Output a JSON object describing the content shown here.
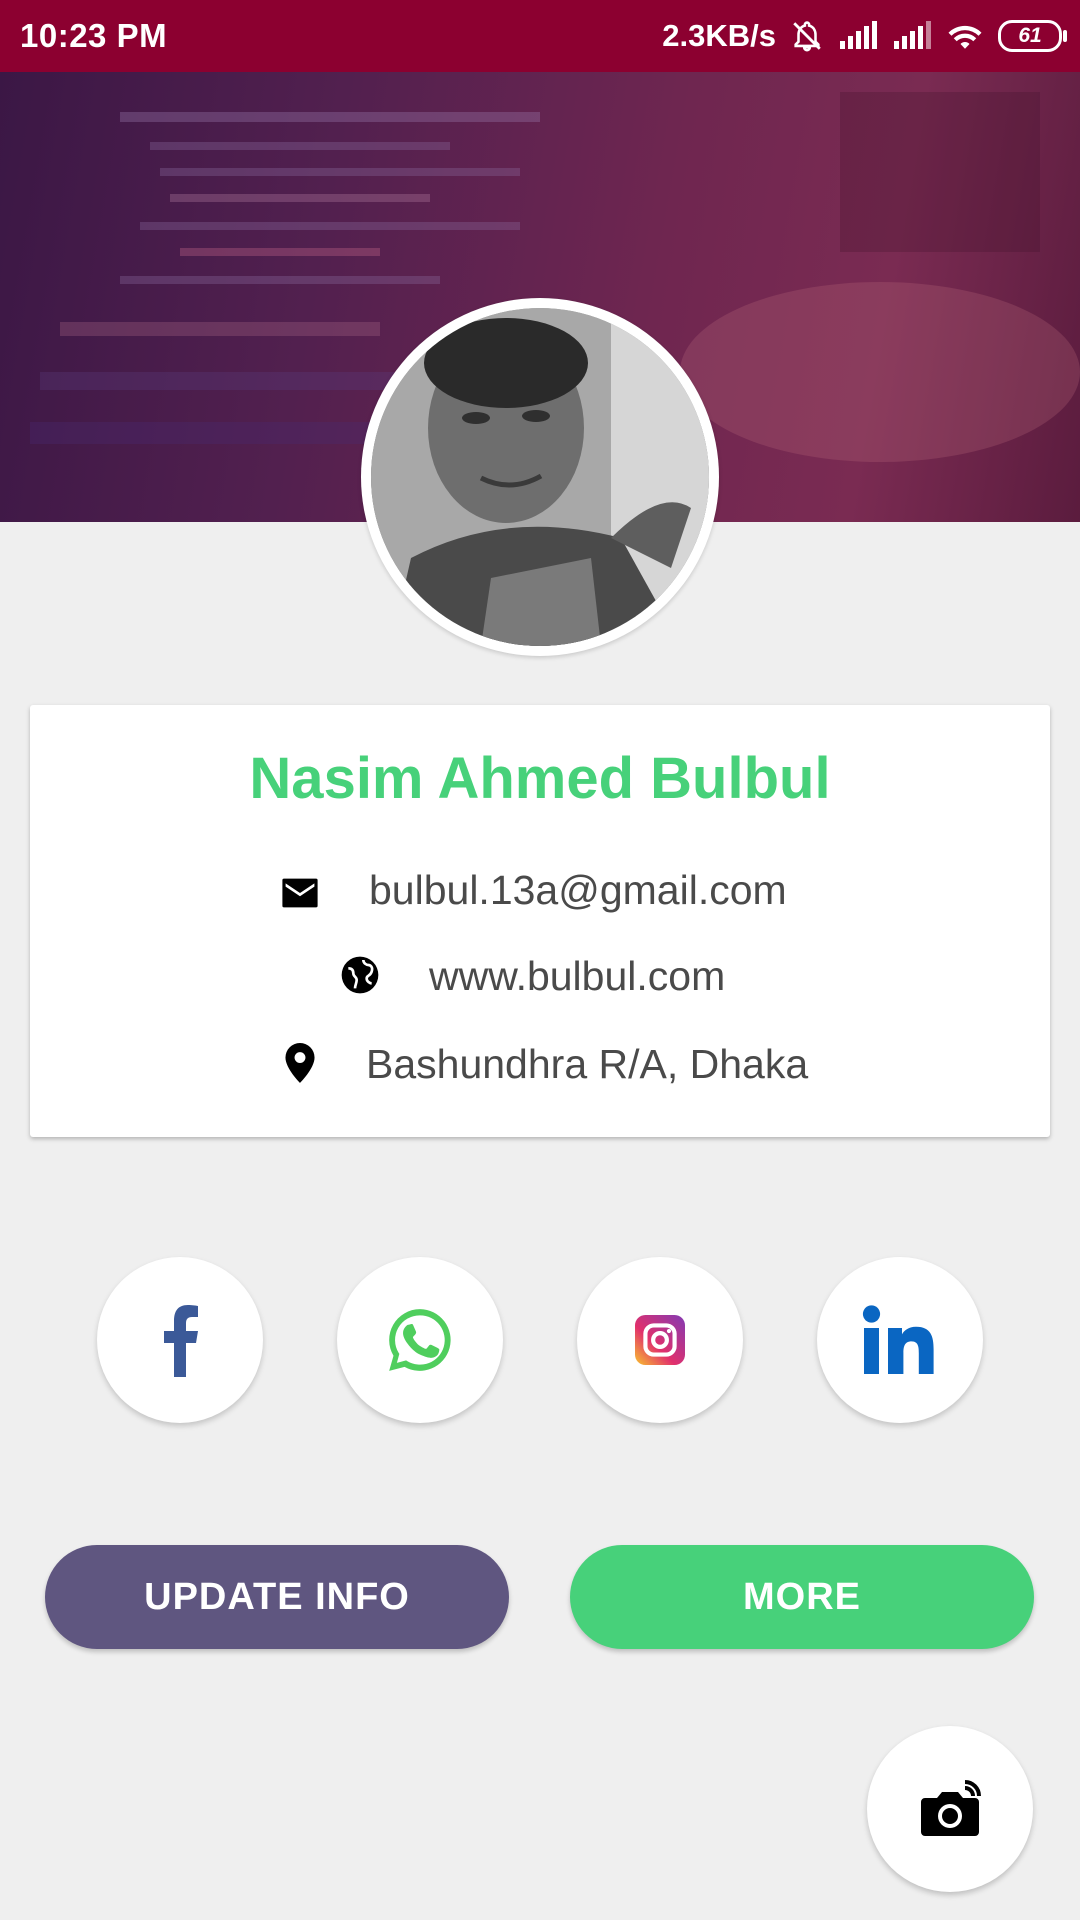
{
  "status_bar": {
    "time": "10:23 PM",
    "net_speed": "2.3KB/s",
    "battery": "61"
  },
  "profile": {
    "name": "Nasim Ahmed Bulbul",
    "email": "bulbul.13a@gmail.com",
    "website": "www.bulbul.com",
    "location": "Bashundhra R/A, Dhaka"
  },
  "social": [
    {
      "icon": "facebook-icon",
      "color": "#3b5998"
    },
    {
      "icon": "whatsapp-icon",
      "color": "#4fce5d"
    },
    {
      "icon": "instagram-icon",
      "color": "#e1306c"
    },
    {
      "icon": "linkedin-icon",
      "color": "#0a66c2"
    }
  ],
  "buttons": {
    "update_label": "UPDATE INFO",
    "more_label": "MORE"
  },
  "colors": {
    "status_bar": "#8c0030",
    "name": "#47d17a",
    "update_button": "#5f5680",
    "more_button": "#47d17a"
  }
}
